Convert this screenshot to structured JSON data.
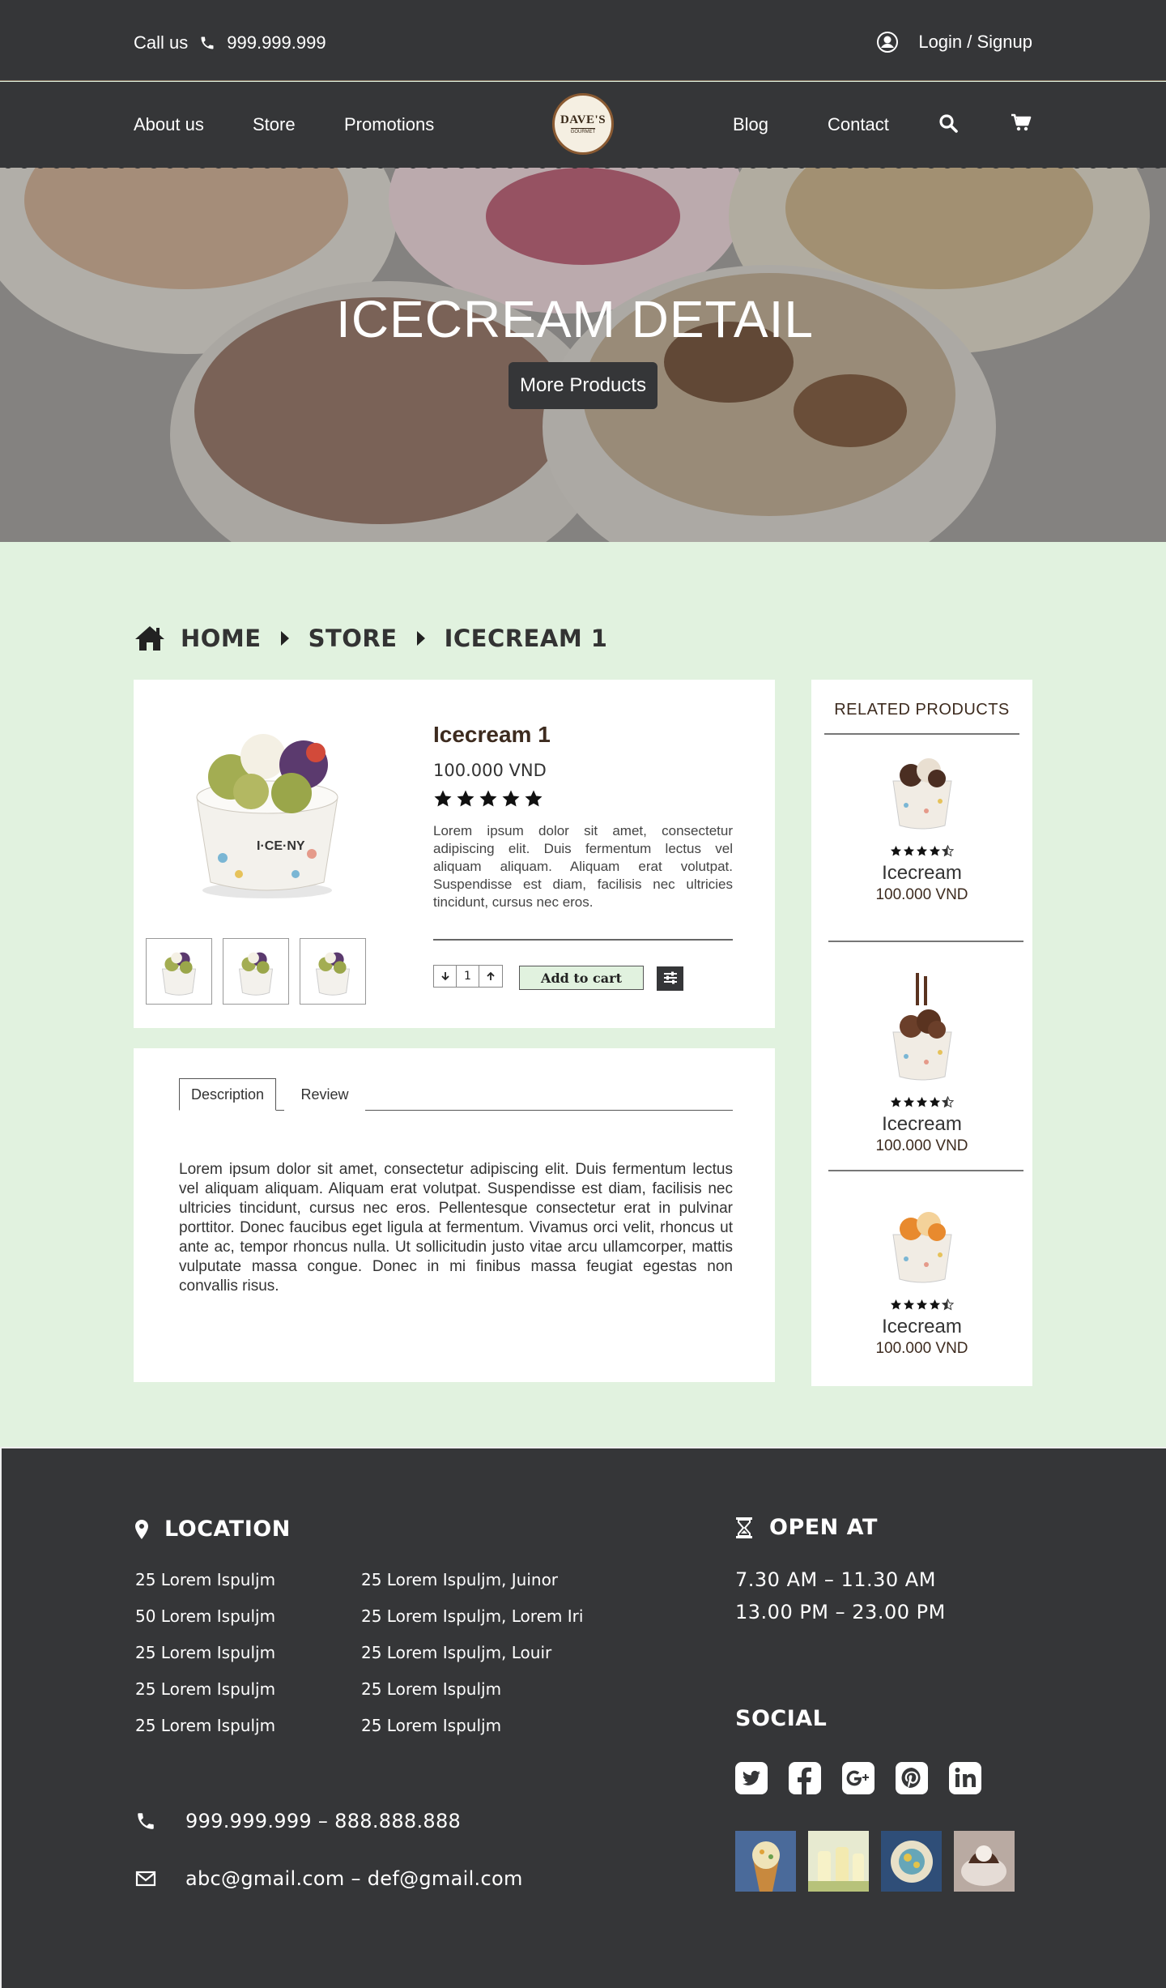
{
  "header": {
    "call_label": "Call us",
    "phone": "999.999.999",
    "login_label": "Login / Signup"
  },
  "nav": {
    "about": "About us",
    "store": "Store",
    "promotions": "Promotions",
    "blog": "Blog",
    "contact": "Contact",
    "logo_text": "DAVE'S",
    "logo_sub": "GOURMET"
  },
  "hero": {
    "title": "ICECREAM DETAIL",
    "button": "More Products"
  },
  "breadcrumb": {
    "home": "HOME",
    "store": "STORE",
    "current": "ICECREAM 1"
  },
  "product": {
    "name": "Icecream 1",
    "price": "100.000 VND",
    "rating": 5,
    "rating_max": 5,
    "description": "Lorem ipsum dolor sit amet, consectetur adipiscing elit. Duis fermentum lectus vel aliquam aliquam. Aliquam erat volutpat. Suspendisse est diam, facilisis nec ultricies tincidunt, cursus nec eros.",
    "quantity": "1",
    "add_to_cart": "Add to cart",
    "thumbnail_count": 3
  },
  "tabs": {
    "description": "Description",
    "review": "Review",
    "active": "Description",
    "content": "Lorem ipsum dolor sit amet, consectetur adipiscing elit. Duis fermentum lectus vel aliquam aliquam. Aliquam erat volutpat. Suspendisse est diam, facilisis nec ultricies tincidunt, cursus nec eros. Pellentesque consectetur erat in pulvinar porttitor. Donec faucibus eget ligula at fermentum. Vivamus orci velit, rhoncus ut ante ac, tempor rhoncus nulla. Ut sollicitudin justo vitae arcu ullamcorper, mattis vulputate massa congue. Donec in mi finibus massa feugiat egestas non convallis risus."
  },
  "related": {
    "title": "RELATED PRODUCTS",
    "items": [
      {
        "name": "Icecream",
        "price": "100.000 VND",
        "rating": 4.5
      },
      {
        "name": "Icecream",
        "price": "100.000 VND",
        "rating": 4.5
      },
      {
        "name": "Icecream",
        "price": "100.000 VND",
        "rating": 4.5
      }
    ]
  },
  "footer": {
    "location_title": "LOCATION",
    "locations_left": [
      "25 Lorem Ispuljm",
      "50 Lorem Ispuljm",
      "25 Lorem Ispuljm",
      "25 Lorem Ispuljm",
      "25 Lorem Ispuljm"
    ],
    "locations_right": [
      "25 Lorem Ispuljm, Juinor",
      "25 Lorem Ispuljm, Lorem Iri",
      "25 Lorem Ispuljm, Louir",
      "25 Lorem Ispuljm",
      "25 Lorem Ispuljm"
    ],
    "phones": "999.999.999 – 888.888.888",
    "emails": "abc@gmail.com – def@gmail.com",
    "open_title": "OPEN AT",
    "hours": [
      "7.30 AM  – 11.30 AM",
      "13.00 PM  – 23.00 PM"
    ],
    "social_title": "SOCIAL",
    "social_icons": [
      "twitter-icon",
      "facebook-icon",
      "google-plus-icon",
      "pinterest-icon",
      "linkedin-icon"
    ]
  },
  "colors": {
    "dark": "#353638",
    "page_bg": "#e1f2df",
    "brown_text": "#3d2b1f",
    "cart_button": "#e1f2df"
  }
}
